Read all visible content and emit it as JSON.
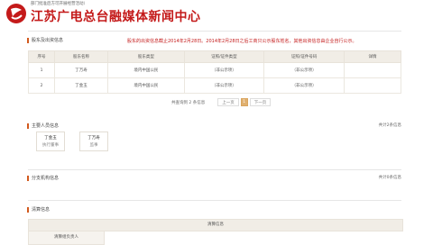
{
  "header": {
    "note": "部门批准后方可开展经营活动）",
    "brand": "江苏广电总台融媒体新闻中心"
  },
  "shareholders": {
    "section_title": "股东及出资信息",
    "notice": "股东的出资信息截止2014年2月28日。2014年2月28日之后工商只公示股东姓名，其他出资信息由企业自行公示。",
    "columns": [
      "序号",
      "股东名称",
      "股东类型",
      "证照/证件类型",
      "证照/证件号码",
      "详情"
    ],
    "rows": [
      [
        "1",
        "丁万寿",
        "境内中国公民",
        "（非公示项）",
        "（非公示项）",
        ""
      ],
      [
        "2",
        "丁金玉",
        "境内中国公民",
        "（非公示项）",
        "（非公示项）",
        ""
      ]
    ],
    "pager": {
      "total": "共查询到 2 条信息",
      "prev": "上一页",
      "current": "1",
      "next": "下一页"
    }
  },
  "personnel": {
    "section_title": "主要人员信息",
    "count": "共计2条信息",
    "people": [
      {
        "name": "丁金玉",
        "role": "执行董事"
      },
      {
        "name": "丁万寿",
        "role": "监事"
      }
    ]
  },
  "branches": {
    "section_title": "分支机构信息",
    "count": "共计0条信息"
  },
  "liquidation": {
    "section_title": "清算信息",
    "header": "清算信息",
    "sub": "清算组负责人"
  },
  "colors": {
    "brand_red": "#c41a1a",
    "accent_orange": "#d25a1e",
    "table_header_bg": "#f1ede6",
    "pager_active": "#e0b070"
  },
  "icons": {
    "logo": "jsbc-logo-icon",
    "section_marker": "section-bar-icon"
  }
}
